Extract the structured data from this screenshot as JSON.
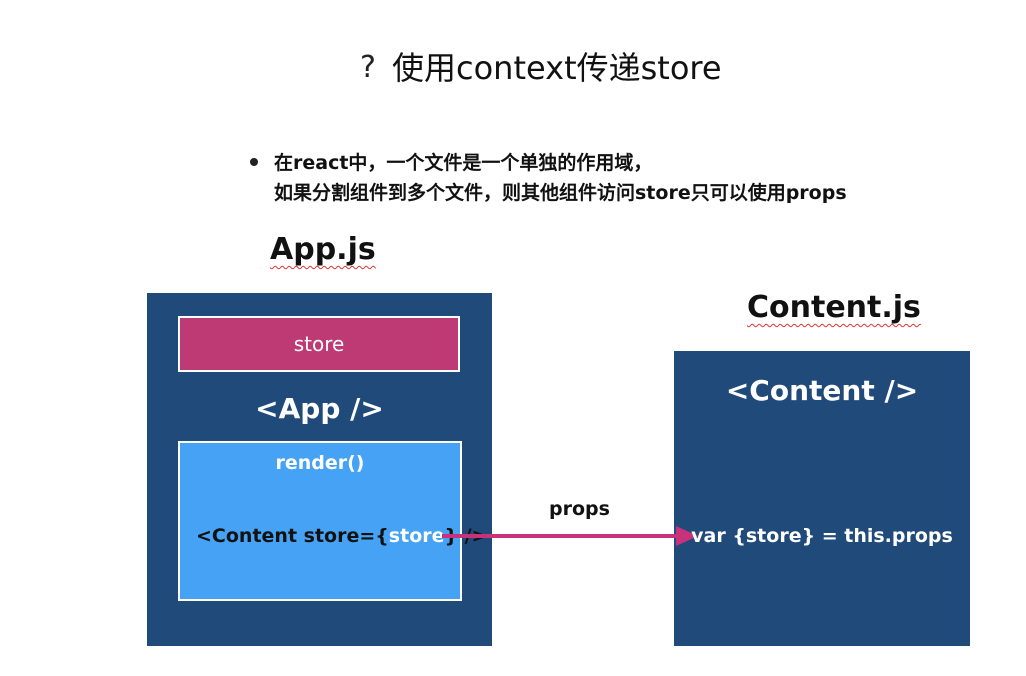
{
  "title": {
    "mark": "?",
    "text": "使用context传递store"
  },
  "bullet": {
    "line1": "在react中，一个文件是一个单独的作用域，",
    "line2": "如果分割组件到多个文件，则其他组件访问store只可以使用props"
  },
  "app_module": {
    "file_label": "App.js",
    "store_label": "store",
    "component_label": "<App />",
    "render_label": "render()",
    "call_prefix": "<Content store=",
    "call_open": "{",
    "call_store": "store",
    "call_close": "}",
    "call_suffix": " />"
  },
  "connector": {
    "label": "props",
    "color": "#c8327a"
  },
  "content_module": {
    "file_label": "Content.js",
    "component_label": "<Content />",
    "var_line": "var {store} = this.props"
  },
  "colors": {
    "module": "#1f4a7a",
    "store": "#bd3a74",
    "render": "#46a2f5"
  }
}
